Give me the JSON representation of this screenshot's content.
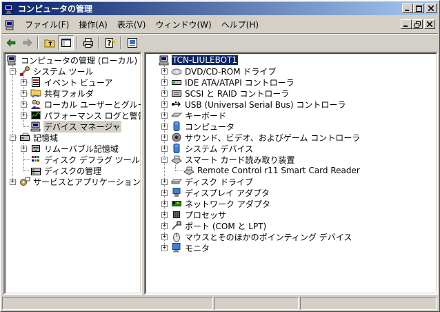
{
  "window": {
    "title": "コンピュータの管理"
  },
  "menu": {
    "items": [
      "ファイル(F)",
      "操作(A)",
      "表示(V)",
      "ウィンドウ(W)",
      "ヘルプ(H)"
    ]
  },
  "toolbar": {
    "icons": [
      "back-icon",
      "forward-icon",
      "up-folder-icon",
      "show-hide-tree-icon",
      "print-icon",
      "help-icon",
      "properties-icon"
    ]
  },
  "left_tree": {
    "root": "コンピュータの管理 (ローカル)",
    "system_tools": "システム ツール",
    "event_viewer": "イベント ビューア",
    "shared_folders": "共有フォルダ",
    "local_users": "ローカル ユーザーとグループ",
    "performance": "パフォーマンス ログと警告",
    "device_manager": "デバイス マネージャ",
    "storage": "記憶域",
    "removable": "リムーバブル記憶域",
    "defrag": "ディスク デフラグ ツール",
    "disk_mgmt": "ディスクの管理",
    "services": "サービスとアプリケーション"
  },
  "right_tree": {
    "computer": "TCN-LIULEBOT1",
    "dvd": "DVD/CD-ROM ドライブ",
    "ide": "IDE ATA/ATAPI コントローラ",
    "scsi": "SCSI と RAID コントローラ",
    "usb": "USB (Universal Serial Bus) コントローラ",
    "keyboard": "キーボード",
    "computer_cat": "コンピュータ",
    "sound": "サウンド、ビデオ、およびゲーム コントローラ",
    "system_devices": "システム デバイス",
    "smartcard": "スマート カード読み取り装置",
    "smartcard_device": "Remote Control r11 Smart Card Reader",
    "disk": "ディスク ドライブ",
    "display": "ディスプレイ アダプタ",
    "network": "ネットワーク アダプタ",
    "processor": "プロセッサ",
    "ports": "ポート (COM と LPT)",
    "mouse": "マウスとそのほかのポインティング デバイス",
    "monitor": "モニタ"
  },
  "colors": {
    "title_start": "#0a246a",
    "title_end": "#a6caf0",
    "face": "#d4d0c8",
    "selection": "#0a246a"
  }
}
